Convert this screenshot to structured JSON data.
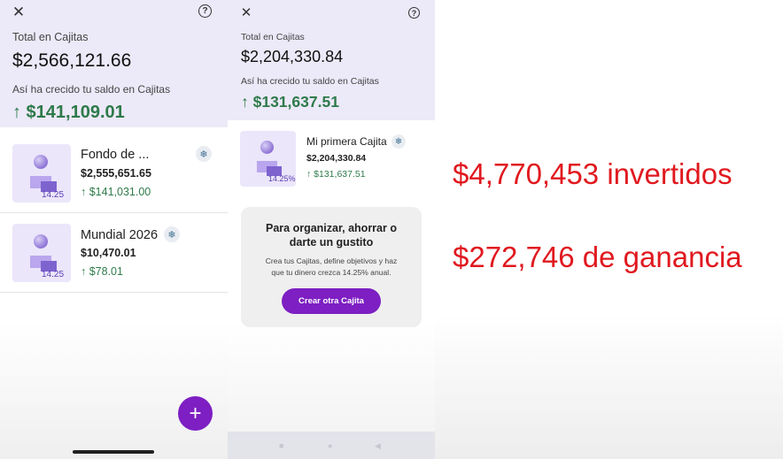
{
  "screens": [
    {
      "total_label": "Total en Cajitas",
      "total_value": "$2,566,121.66",
      "growth_label": "Así ha crecido tu saldo en Cajitas",
      "growth_value": "↑ $141,109.01",
      "items": [
        {
          "name": "Fondo de ...",
          "balance": "$2,555,651.65",
          "gain": "↑ $141,031.00",
          "rate": "14.25"
        },
        {
          "name": "Mundial 2026",
          "balance": "$10,470.01",
          "gain": "↑ $78.01",
          "rate": "14.25"
        }
      ],
      "fab_label": "+"
    },
    {
      "total_label": "Total en Cajitas",
      "total_value": "$2,204,330.84",
      "growth_label": "Así ha crecido tu saldo en Cajitas",
      "growth_value": "↑ $131,637.51",
      "items": [
        {
          "name": "Mi primera Cajita",
          "balance": "$2,204,330.84",
          "gain": "↑ $131,637.51",
          "rate": "14.25%"
        }
      ],
      "promo": {
        "title_line1": "Para organizar, ahorrar o",
        "title_line2": "darte un gustito",
        "body_line1": "Crea tus Cajitas, define objetivos y haz",
        "body_line2": "que tu dinero crezca 14.25% anual.",
        "button": "Crear otra Cajita"
      }
    }
  ],
  "overlay": {
    "invested": "$4,770,453 invertidos",
    "profit": "$272,746 de ganancia"
  },
  "icons": {
    "close": "close-icon",
    "help": "help-icon",
    "snow": "snowflake-icon",
    "add": "plus-icon"
  },
  "colors": {
    "accent": "#7d1fc2",
    "gain": "#2e7a4a",
    "header": "#ece9f8",
    "overlay_text": "#e0191f"
  }
}
